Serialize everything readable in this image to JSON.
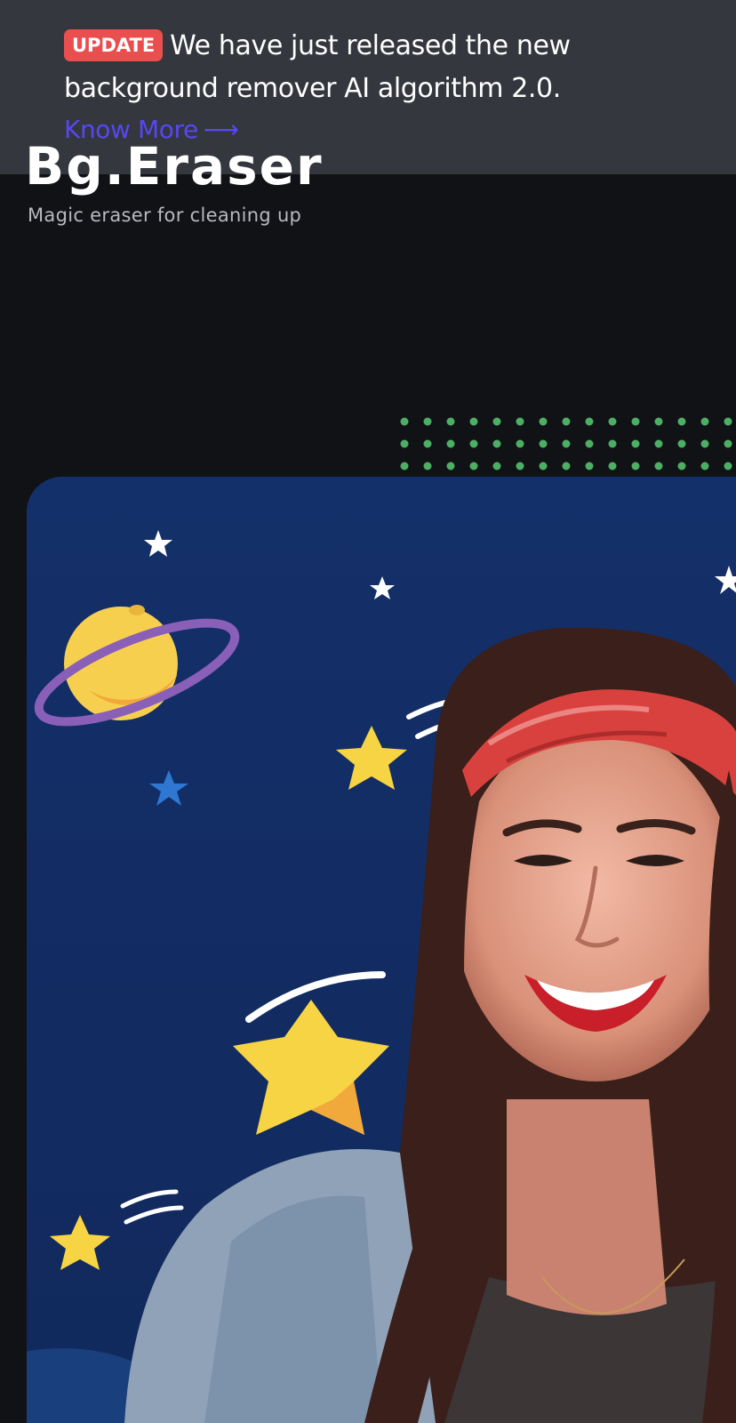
{
  "banner": {
    "badge": "UPDATE",
    "message": "We have just released the new background remover AI algorithm 2.0.",
    "link_label": "Know More",
    "link_arrow": "⟶"
  },
  "brand": {
    "title": "Bg.Eraser",
    "tagline": "Magic eraser for cleaning up"
  },
  "hero": {
    "image_subject": "smiling-woman-photo-on-space-background"
  },
  "colors": {
    "page_background": "#111216",
    "banner_background": "#34373d",
    "badge": "#e94f4f",
    "link": "#5747f2",
    "dots": "#4caf63",
    "hero_background": "#133068"
  }
}
